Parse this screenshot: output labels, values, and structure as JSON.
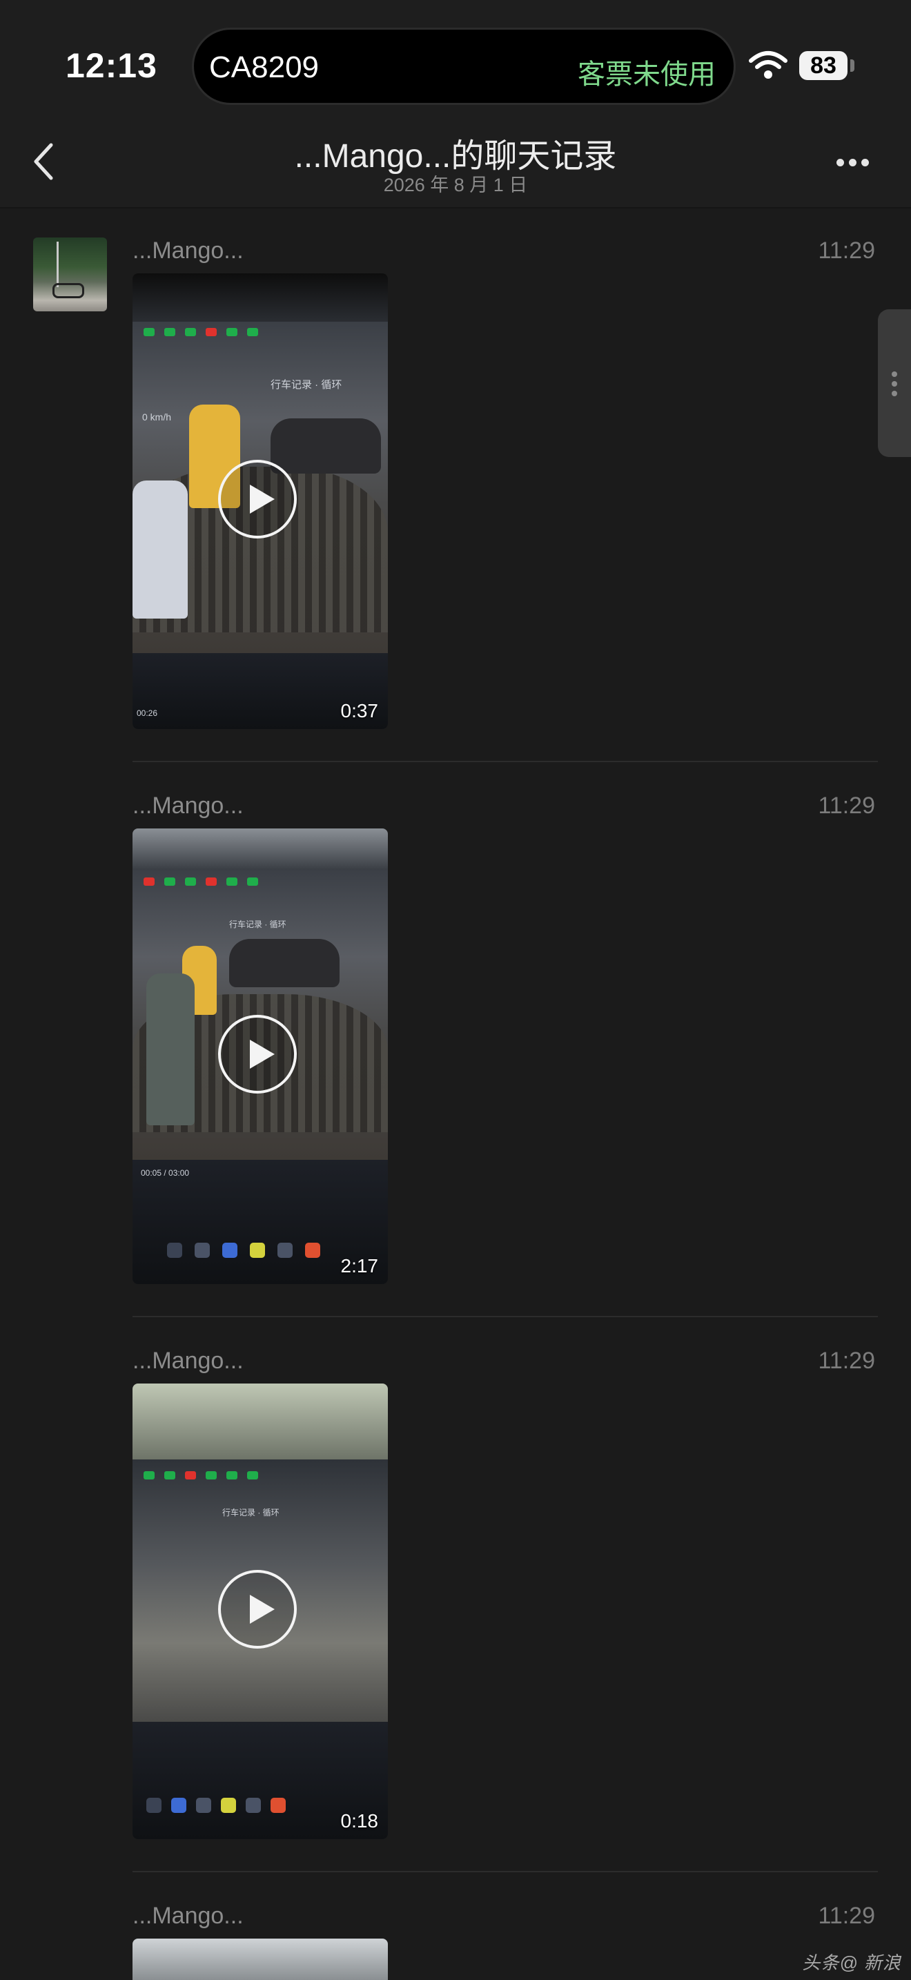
{
  "status_bar": {
    "time": "12:13",
    "island_flight": "CA8209",
    "island_status": "客票未使用",
    "battery_level": "83"
  },
  "nav": {
    "title": "...Mango...的聊天记录",
    "date": "2026 年 8 月 1 日"
  },
  "messages": [
    {
      "sender": "...Mango...",
      "time": "11:29",
      "duration": "0:37",
      "overlay_title": "行车记录 · 循环",
      "speed": "0 km/h",
      "timecode": "00:26"
    },
    {
      "sender": "...Mango...",
      "time": "11:29",
      "duration": "2:17",
      "overlay_title": "行车记录 · 循环",
      "timecode": "00:05 / 03:00"
    },
    {
      "sender": "...Mango...",
      "time": "11:29",
      "duration": "0:18",
      "overlay_title": "行车记录 · 循环"
    },
    {
      "sender": "...Mango...",
      "time": "11:29"
    }
  ],
  "watermark": "头条@ 新浪"
}
